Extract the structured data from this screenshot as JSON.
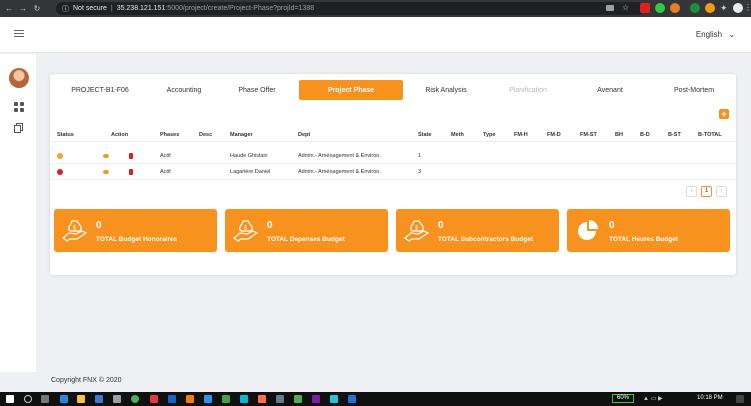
{
  "browser": {
    "security_label": "Not secure",
    "url_host": "35.238.121.151",
    "url_path": ":5000/project/create/Project-Phase?projId=1388"
  },
  "topbar": {
    "language": "English"
  },
  "tabs": [
    {
      "label": "PROJECT-B1-F06",
      "state": "normal"
    },
    {
      "label": "Accounting",
      "state": "normal"
    },
    {
      "label": "Phase Offer",
      "state": "normal"
    },
    {
      "label": "Project Phase",
      "state": "active"
    },
    {
      "label": "Risk Analysis",
      "state": "normal"
    },
    {
      "label": "Planification",
      "state": "disabled"
    },
    {
      "label": "Avenant",
      "state": "normal"
    },
    {
      "label": "Post-Mortem",
      "state": "normal"
    }
  ],
  "add_button": "+",
  "table": {
    "headers": [
      "Status",
      "Action",
      "Phases",
      "Desc",
      "Manager",
      "Dept",
      "State",
      "Meth",
      "Type",
      "FM-H",
      "FM-D",
      "FM-ST",
      "BH",
      "B-D",
      "B-ST",
      "B-TOTAL"
    ],
    "rows": [
      {
        "status_color": "#f5a623",
        "phase": "Actif",
        "desc": "",
        "manager": "Haude Ghislain",
        "dept": "Admin.- Aménagement & Environ.",
        "state": "1"
      },
      {
        "status_color": "#e02020",
        "phase": "Actif",
        "desc": "",
        "manager": "Lagarière Daniel",
        "dept": "Admin.- Aménagement & Environ.",
        "state": "3"
      }
    ]
  },
  "pagination": {
    "prev": "‹",
    "current": "1",
    "next": "›"
  },
  "kpis": [
    {
      "value": "0",
      "label": "TOTAL Budget Honoraires",
      "icon": "money-hand-icon"
    },
    {
      "value": "0",
      "label": "TOTAL Depenses Budget",
      "icon": "money-hand-icon"
    },
    {
      "value": "0",
      "label": "TOTAL Subcontractors Budget",
      "icon": "money-hand-icon"
    },
    {
      "value": "0",
      "label": "TOTAL Heures Budget",
      "icon": "pie-chart-icon"
    }
  ],
  "footer": "Copyright FNX © 2020",
  "taskbar": {
    "battery": "60%",
    "time": "10:18 PM"
  },
  "colors": {
    "accent": "#f7921e",
    "danger": "#e02020"
  }
}
